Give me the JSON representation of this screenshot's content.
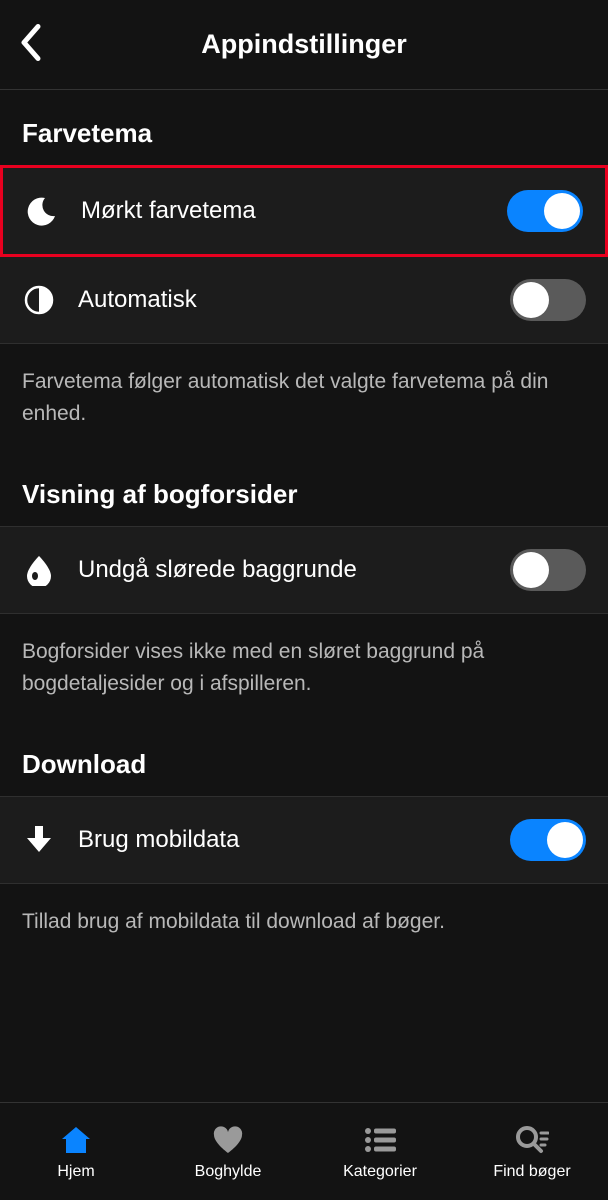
{
  "header": {
    "title": "Appindstillinger"
  },
  "sections": {
    "theme": {
      "title": "Farvetema",
      "darkTheme": {
        "label": "Mørkt farvetema",
        "on": true
      },
      "automatic": {
        "label": "Automatisk",
        "on": false
      },
      "description": "Farvetema følger automatisk det valgte farvetema på din enhed."
    },
    "covers": {
      "title": "Visning af bogforsider",
      "avoidBlur": {
        "label": "Undgå slørede baggrunde",
        "on": false
      },
      "description": "Bogforsider vises ikke med en sløret baggrund på bogdetaljesider og i afspilleren."
    },
    "download": {
      "title": "Download",
      "useMobileData": {
        "label": "Brug mobildata",
        "on": true
      },
      "description": "Tillad brug af mobildata til download af bøger."
    }
  },
  "tabs": {
    "home": "Hjem",
    "shelf": "Boghylde",
    "categories": "Kategorier",
    "find": "Find bøger"
  }
}
